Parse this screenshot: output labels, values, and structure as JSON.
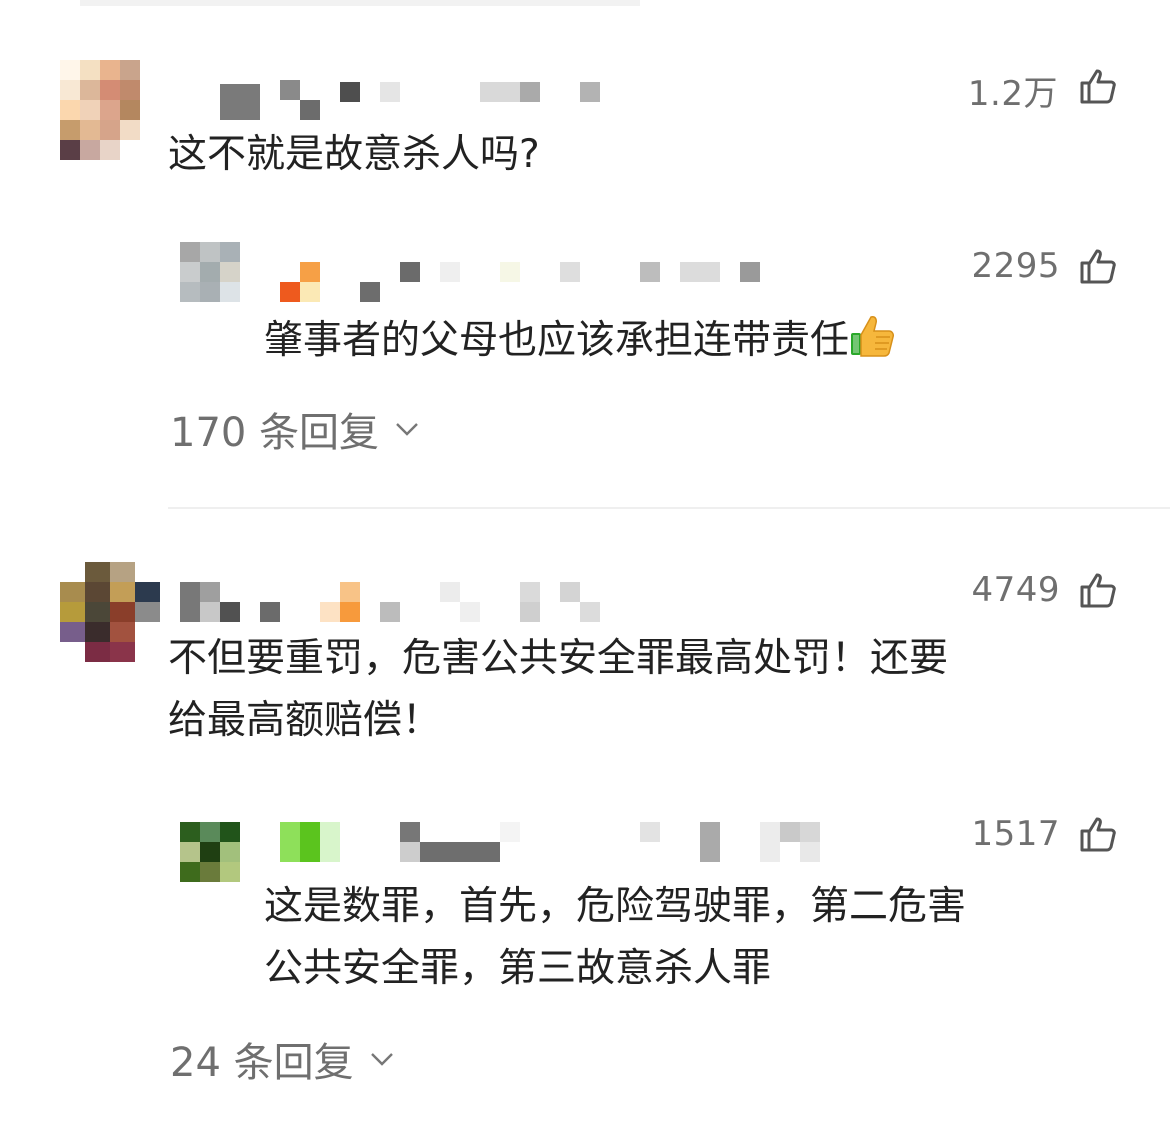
{
  "comments": [
    {
      "text": "这不就是故意杀人吗?",
      "likes": "1.2万",
      "reply": {
        "text": "肇事者的父母也应该承担连带责任",
        "emoji": "thumbs-up-emoji",
        "likes": "2295"
      },
      "replies_label": "170 条回复"
    },
    {
      "text_line1": "不但要重罚，危害公共安全罪最高处罚！还要",
      "text_line2": "给最高额赔偿！",
      "likes": "4749",
      "reply": {
        "text_line1": "这是数罪，首先，危险驾驶罪，第二危害",
        "text_line2": "公共安全罪，第三故意杀人罪",
        "likes": "1517"
      },
      "replies_label": "24 条回复"
    }
  ],
  "colors": {
    "text": "#222222",
    "meta": "#6f6f6f",
    "divider": "#efefef"
  },
  "icons": [
    "thumbs-up-icon",
    "chevron-down-icon"
  ]
}
